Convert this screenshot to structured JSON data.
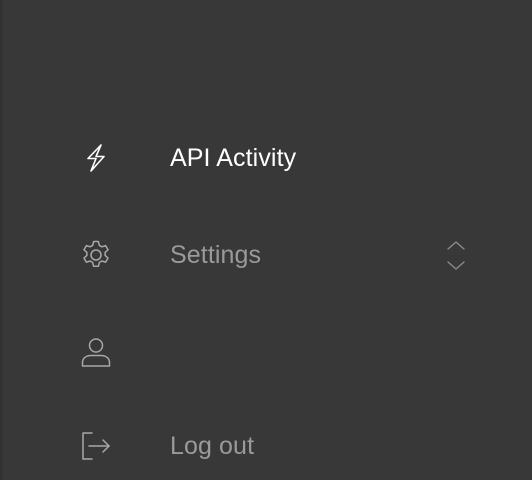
{
  "nav": {
    "items": [
      {
        "label": "API Activity",
        "icon": "lightning-icon",
        "active": true
      },
      {
        "label": "Settings",
        "icon": "gear-icon",
        "active": false,
        "expandable": true
      },
      {
        "label": "",
        "icon": "user-icon",
        "active": false
      },
      {
        "label": "Log out",
        "icon": "logout-icon",
        "active": false
      }
    ]
  },
  "colors": {
    "background": "#383838",
    "active_text": "#ffffff",
    "inactive_text": "#9a9a9a",
    "inactive_icon": "#a8a8a8"
  }
}
